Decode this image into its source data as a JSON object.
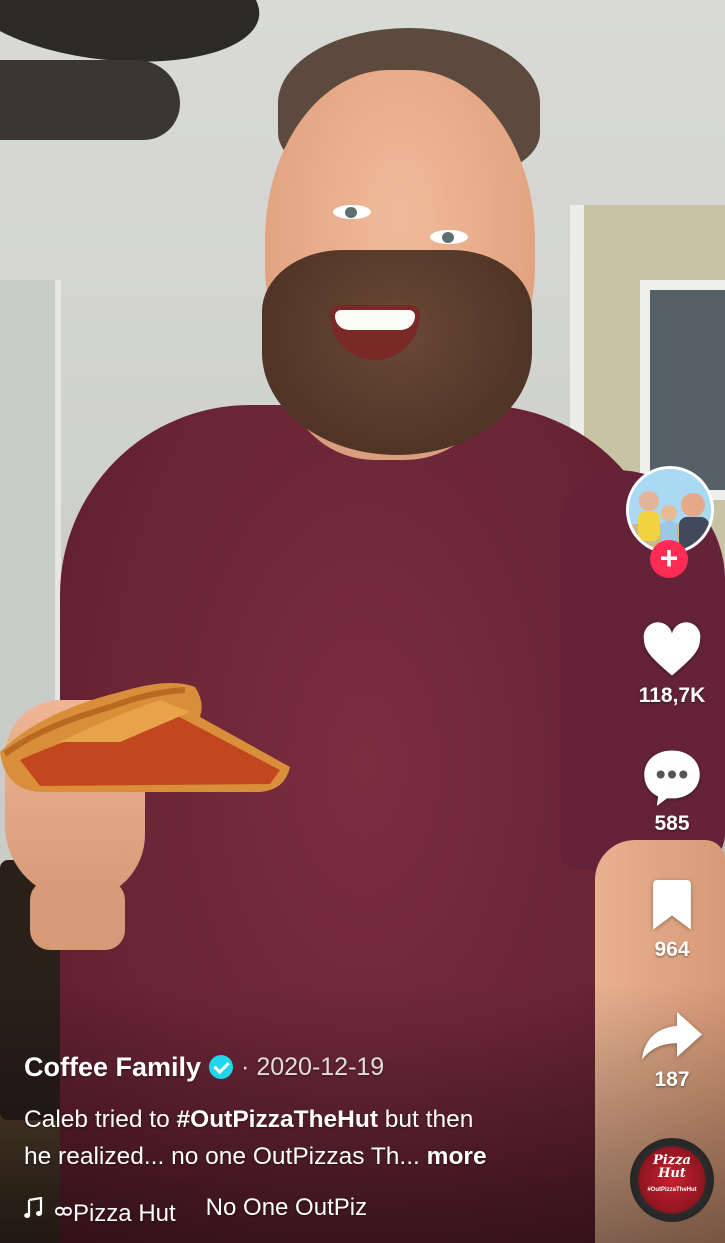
{
  "video": {
    "author": "Coffee Family",
    "date": "2020-12-19",
    "date_separator": "·",
    "caption_prefix": "Caleb tried to ",
    "hashtag": "#OutPizzaTheHut",
    "caption_middle": " but then",
    "caption_line2": "he realized... no one OutPizzas Th... ",
    "more_label": "more",
    "music": {
      "icon": "music-note-icon",
      "sound_author": "ᢁPizza Hut",
      "sound_title": "No One OutPiz"
    },
    "disc_logo": "Pizza Hut",
    "disc_tag": "#OutPizzaTheHut"
  },
  "actions": {
    "follow_icon": "plus-icon",
    "likes": "118,7K",
    "comments": "585",
    "bookmarks": "964",
    "shares": "187"
  },
  "colors": {
    "follow": "#fe2c55",
    "verified": "#20d5ec",
    "icon": "#ffffff"
  }
}
